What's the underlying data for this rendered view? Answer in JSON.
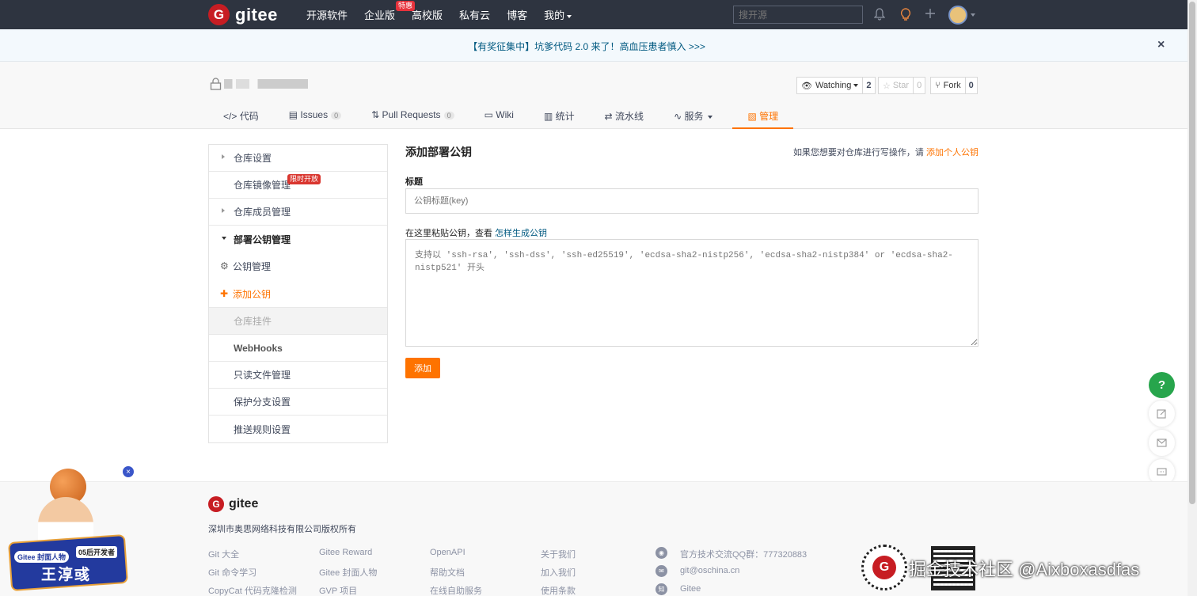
{
  "topnav": {
    "logo_text": "gitee",
    "logo_letter": "G",
    "links": [
      "开源软件",
      "企业版",
      "高校版",
      "私有云",
      "博客",
      "我的"
    ],
    "enterprise_badge": "特惠",
    "search_placeholder": "搜开源",
    "icons": [
      "bell-icon",
      "lightbulb-icon",
      "plus-icon",
      "user-avatar"
    ]
  },
  "announcement": {
    "text": "【有奖征集中】坑爹代码 2.0 来了！高血压患者慎入 >>>",
    "close": "×"
  },
  "project": {
    "watch_label": "Watching",
    "watch_count": "2",
    "star_label": "Star",
    "star_count": "0",
    "fork_label": "Fork",
    "fork_count": "0",
    "tabs": [
      {
        "icon": "</>",
        "label": "代码",
        "count": ""
      },
      {
        "icon": "▤",
        "label": "Issues",
        "count": "0"
      },
      {
        "icon": "⇅",
        "label": "Pull Requests",
        "count": "0"
      },
      {
        "icon": "▭",
        "label": "Wiki",
        "count": ""
      },
      {
        "icon": "▥",
        "label": "统计",
        "count": ""
      },
      {
        "icon": "⇄",
        "label": "流水线",
        "count": ""
      },
      {
        "icon": "∿",
        "label": "服务",
        "count": ""
      },
      {
        "icon": "▧",
        "label": "管理",
        "count": ""
      }
    ],
    "active_tab": "管理"
  },
  "sidebar": {
    "items": [
      {
        "label": "仓库设置"
      },
      {
        "label": "仓库镜像管理",
        "badge": "限时开放"
      },
      {
        "label": "仓库成员管理"
      },
      {
        "label": "部署公钥管理"
      }
    ],
    "sub_items": [
      {
        "icon": "⚙",
        "label": "公钥管理"
      },
      {
        "icon": "✚",
        "label": "添加公钥"
      }
    ],
    "more_items": [
      {
        "label": "仓库挂件"
      },
      {
        "label": "WebHooks"
      },
      {
        "label": "只读文件管理"
      },
      {
        "label": "保护分支设置"
      },
      {
        "label": "推送规则设置"
      }
    ]
  },
  "form": {
    "title": "添加部署公钥",
    "hint_prefix": "如果您想要对仓库进行写操作，请",
    "hint_link": "添加个人公钥",
    "title_label": "标题",
    "title_placeholder": "公钥标题(key)",
    "key_label": "在这里粘贴公钥，查看",
    "key_label_link": "怎样生成公钥",
    "key_placeholder": "支持以 'ssh-rsa', 'ssh-dss', 'ssh-ed25519', 'ecdsa-sha2-nistp256', 'ecdsa-sha2-nistp384' or 'ecdsa-sha2-nistp521' 开头",
    "submit_label": "添加"
  },
  "floating": {
    "help": "?",
    "icons": [
      "edit-icon",
      "mail-icon",
      "chat-icon"
    ]
  },
  "footer": {
    "logo_text": "gitee",
    "copyright": "深圳市奥思网络科技有限公司版权所有",
    "columns": [
      [
        "Git 大全",
        "Git 命令学习",
        "CopyCat 代码克隆检测"
      ],
      [
        "Gitee Reward",
        "Gitee 封面人物",
        "GVP 项目"
      ],
      [
        "OpenAPI",
        "帮助文档",
        "在线自助服务"
      ],
      [
        "关于我们",
        "加入我们",
        "使用条款"
      ]
    ],
    "contacts": [
      "官方技术交流QQ群：777320883",
      "git@oschina.cn",
      "Gitee"
    ],
    "watermark": "掘金技术社区 @Aixboxasdfas"
  },
  "promo": {
    "tag1": "Gitee 封面人物",
    "tag2": "05后开发者",
    "name": "王淳彧",
    "close": "×"
  },
  "colors": {
    "nav_bg": "#2e3440",
    "accent": "#fe7300",
    "brand_red": "#c71d23",
    "link_blue": "#005980",
    "help_green": "#27a54c"
  }
}
